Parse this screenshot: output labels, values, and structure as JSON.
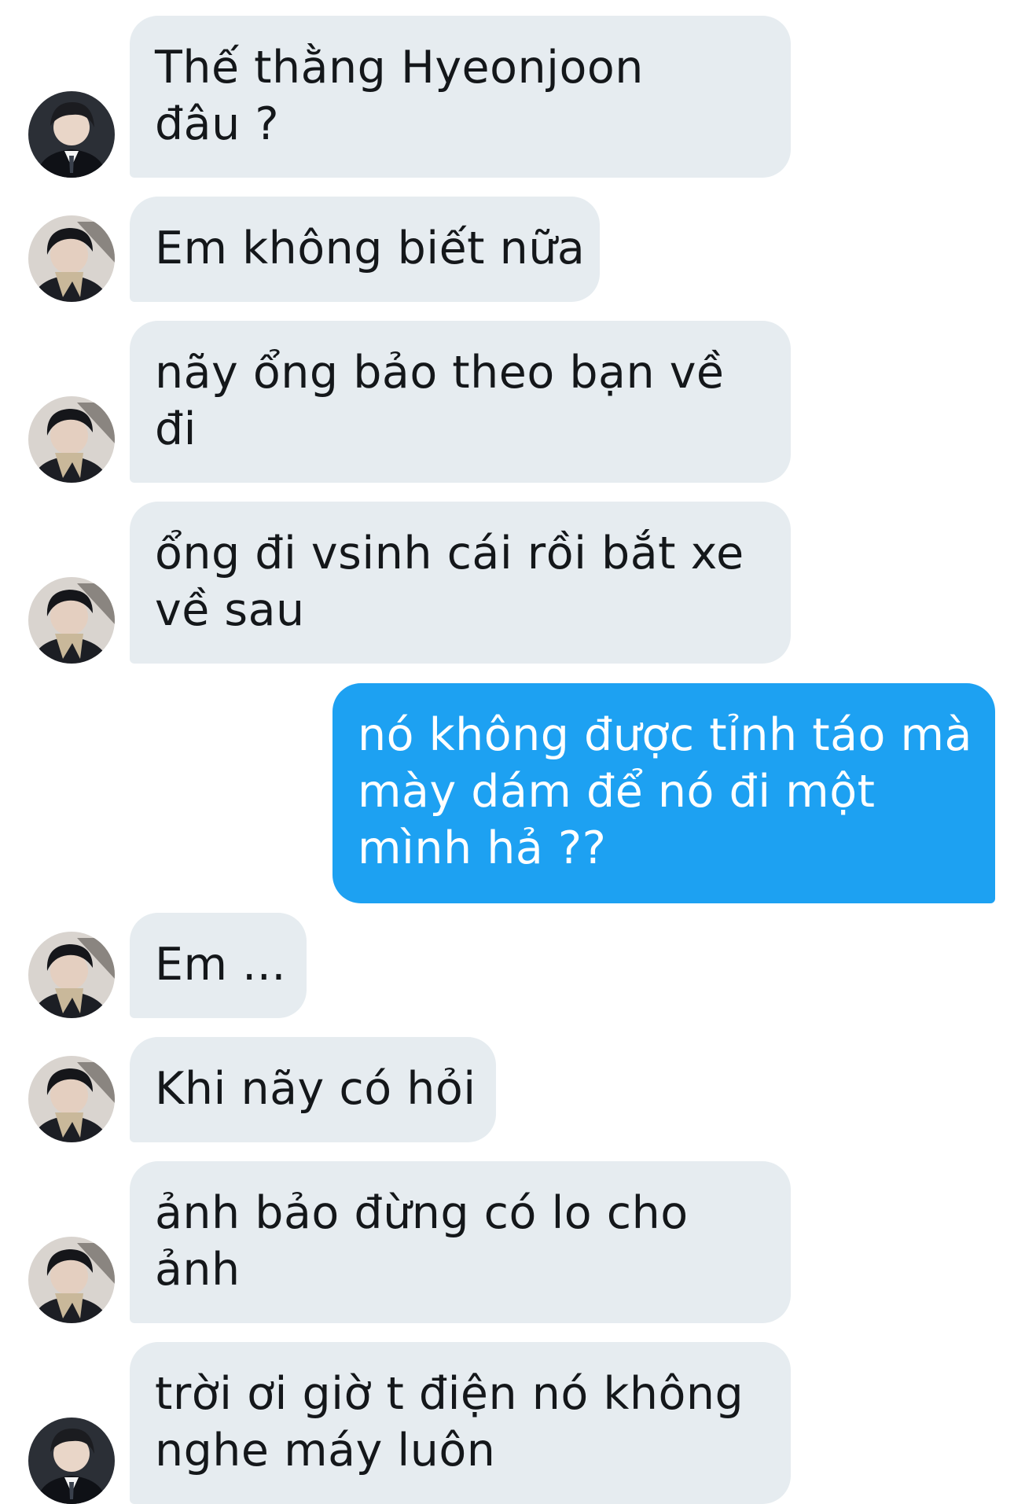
{
  "colors": {
    "incoming_bubble": "#e6ecf0",
    "incoming_text": "#14171a",
    "outgoing_bubble": "#1da1f2",
    "outgoing_text": "#ffffff"
  },
  "messages": [
    {
      "direction": "incoming",
      "avatar": "avatar-suit",
      "lines": [
        "Thế thằng Hyeonjoon",
        "đâu ?"
      ]
    },
    {
      "direction": "incoming",
      "avatar": "avatar-scarf",
      "lines": [
        "Em không biết nữa"
      ]
    },
    {
      "direction": "incoming",
      "avatar": "avatar-scarf",
      "lines": [
        "nãy ổng bảo theo bạn về",
        "đi"
      ]
    },
    {
      "direction": "incoming",
      "avatar": "avatar-scarf",
      "lines": [
        "ổng đi vsinh cái rồi bắt xe",
        "về sau"
      ]
    },
    {
      "direction": "outgoing",
      "lines": [
        "nó không được tỉnh táo mà",
        "mày dám để nó đi một",
        "mình hả ??"
      ]
    },
    {
      "direction": "incoming",
      "avatar": "avatar-scarf",
      "lines": [
        "Em ..."
      ]
    },
    {
      "direction": "incoming",
      "avatar": "avatar-scarf",
      "lines": [
        "Khi nãy có hỏi"
      ]
    },
    {
      "direction": "incoming",
      "avatar": "avatar-scarf",
      "lines": [
        "ảnh bảo đừng có lo cho",
        "ảnh"
      ]
    },
    {
      "direction": "incoming",
      "avatar": "avatar-suit",
      "lines": [
        "trời ơi giờ t điện nó không",
        "nghe máy luôn"
      ]
    }
  ]
}
